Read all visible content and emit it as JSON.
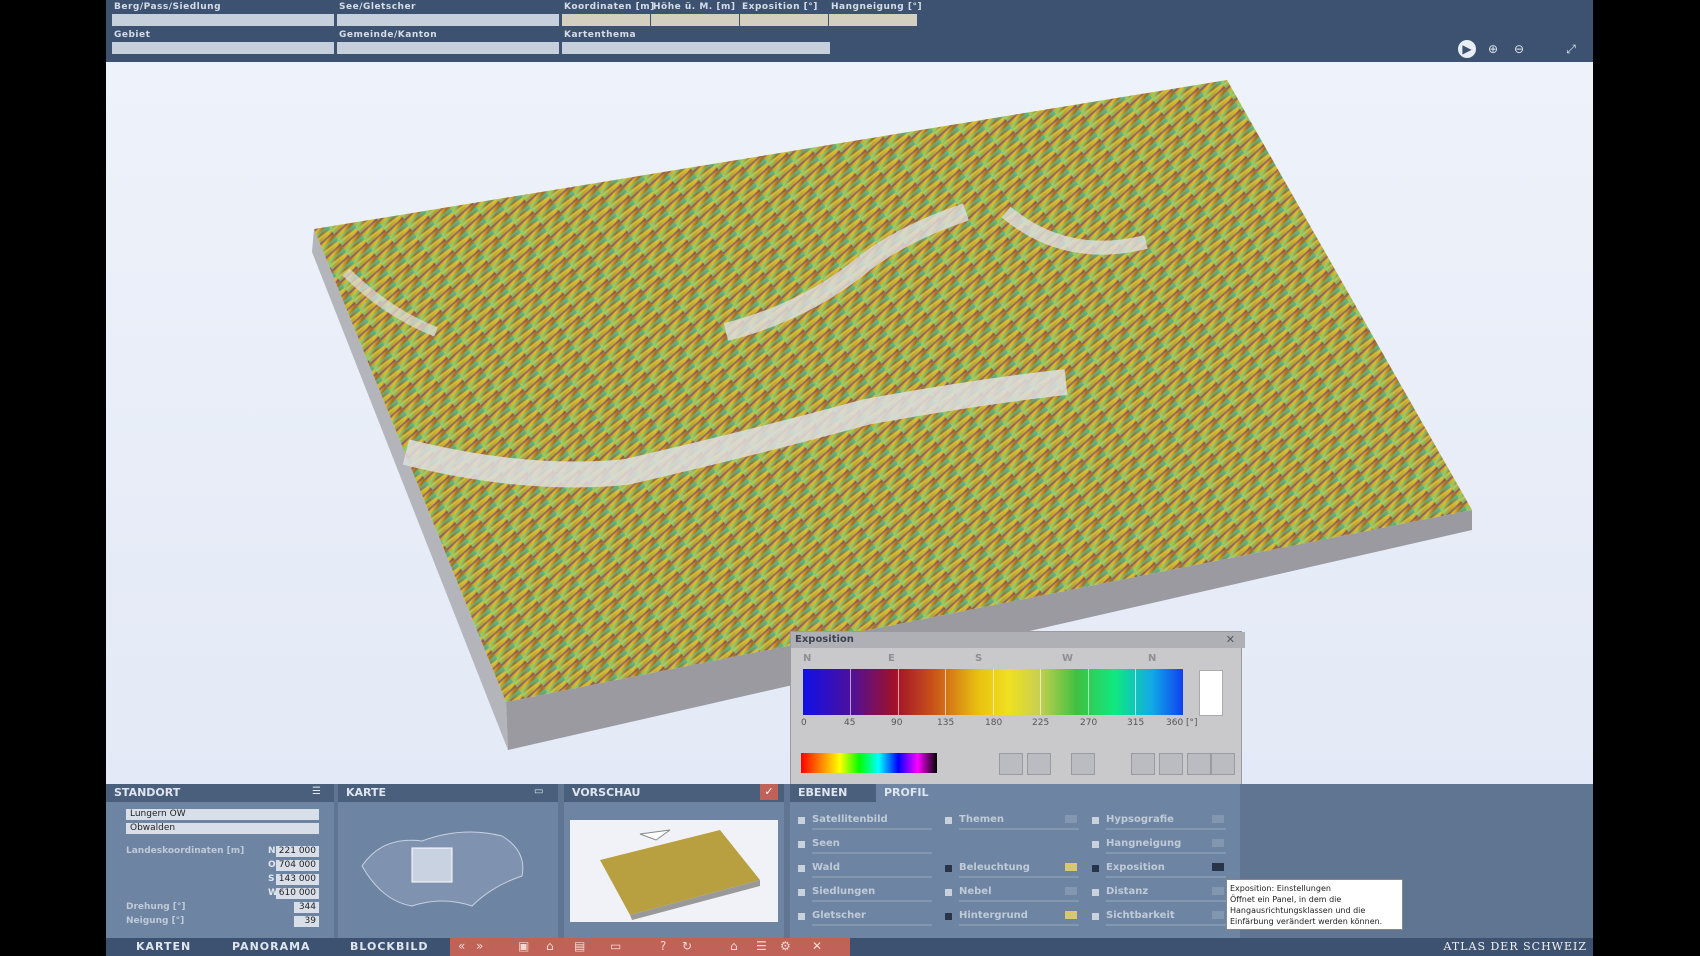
{
  "search": {
    "berg_label": "Berg/Pass/Siedlung",
    "see_label": "See/Gletscher",
    "koord_label": "Koordinaten [m]",
    "hoehe_label": "Höhe ü. M. [m]",
    "exposition_label": "Exposition [°]",
    "hangneigung_label": "Hangneigung [°]",
    "gebiet_label": "Gebiet",
    "gemeinde_label": "Gemeinde/Kanton",
    "kartenthema_label": "Kartenthema"
  },
  "toolbar_icons": [
    "play-icon",
    "zoom-in-icon",
    "zoom-out-icon",
    "fit-view-icon"
  ],
  "exposition_panel": {
    "title": "Exposition",
    "directions": [
      "N",
      "E",
      "S",
      "W",
      "N"
    ],
    "ticks": [
      "0",
      "45",
      "90",
      "135",
      "180",
      "225",
      "270",
      "315",
      "360 [°]"
    ],
    "colors": [
      "#1010e8",
      "#a0102a",
      "#e8c010",
      "#40c040",
      "#1040f0"
    ]
  },
  "standort": {
    "header": "STANDORT",
    "place": "Lungern   OW",
    "region": "Obwalden",
    "coords_label": "Landeskoordinaten [m]",
    "n_label": "N",
    "n_value": "221 000",
    "o_label": "O",
    "o_value": "704 000",
    "s_label": "S",
    "s_value": "143 000",
    "w_label": "W",
    "w_value": "610 000",
    "drehung_label": "Drehung [°]",
    "drehung_value": "344",
    "neigung_label": "Neigung [°]",
    "neigung_value": "39"
  },
  "karte": {
    "header": "KARTE"
  },
  "vorschau": {
    "header": "VORSCHAU"
  },
  "layers": {
    "tab_ebenen": "EBENEN",
    "tab_profil": "PROFIL",
    "col1": [
      "Satellitenbild",
      "Seen",
      "Wald",
      "Siedlungen",
      "Gletscher"
    ],
    "col2": [
      "Themen",
      "Beleuchtung",
      "Nebel",
      "Hintergrund"
    ],
    "col3": [
      "Hypsografie",
      "Hangneigung",
      "Exposition",
      "Distanz",
      "Sichtbarkeit"
    ]
  },
  "tooltip": {
    "title": "Exposition: Einstellungen",
    "body": "Öffnet ein Panel, in dem die Hangausrichtungsklassen und die Einfärbung verändert werden können."
  },
  "nav": {
    "karten": "KARTEN",
    "panorama": "PANORAMA",
    "blockbild": "BLOCKBILD",
    "brand": "ATLAS DER SCHWEIZ"
  }
}
